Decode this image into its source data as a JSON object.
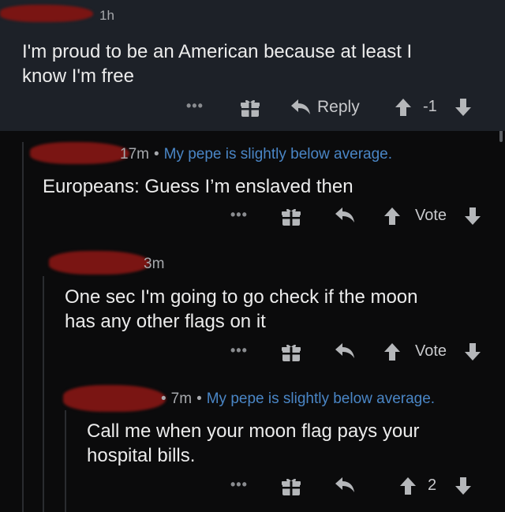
{
  "comments": [
    {
      "time": "1h",
      "flair": "",
      "text_lines": [
        "I'm proud to be an American because at least I",
        "know I'm free"
      ],
      "more_label": "•••",
      "reply_label": "Reply",
      "score": "-1"
    },
    {
      "time": "17m",
      "flair": "My pepe is slightly below average.",
      "text_lines": [
        "Europeans: Guess I’m enslaved then"
      ],
      "more_label": "•••",
      "score": "Vote"
    },
    {
      "time": "3m",
      "flair": "",
      "text_lines": [
        "One sec I'm going to go check if the moon",
        "has any other flags on it"
      ],
      "more_label": "•••",
      "score": "Vote"
    },
    {
      "time": "7m",
      "flair": "My pepe is slightly below average.",
      "text_lines": [
        "Call me when your moon flag pays your",
        "hospital bills."
      ],
      "more_label": "•••",
      "score": "2"
    }
  ],
  "colors": {
    "highlight_bg": "#1d2128",
    "flair_blue": "#4a86c6",
    "redaction": "#7a1513"
  },
  "icons": [
    "gift-icon",
    "reply-arrow-icon",
    "upvote-icon",
    "downvote-icon",
    "more-icon"
  ]
}
